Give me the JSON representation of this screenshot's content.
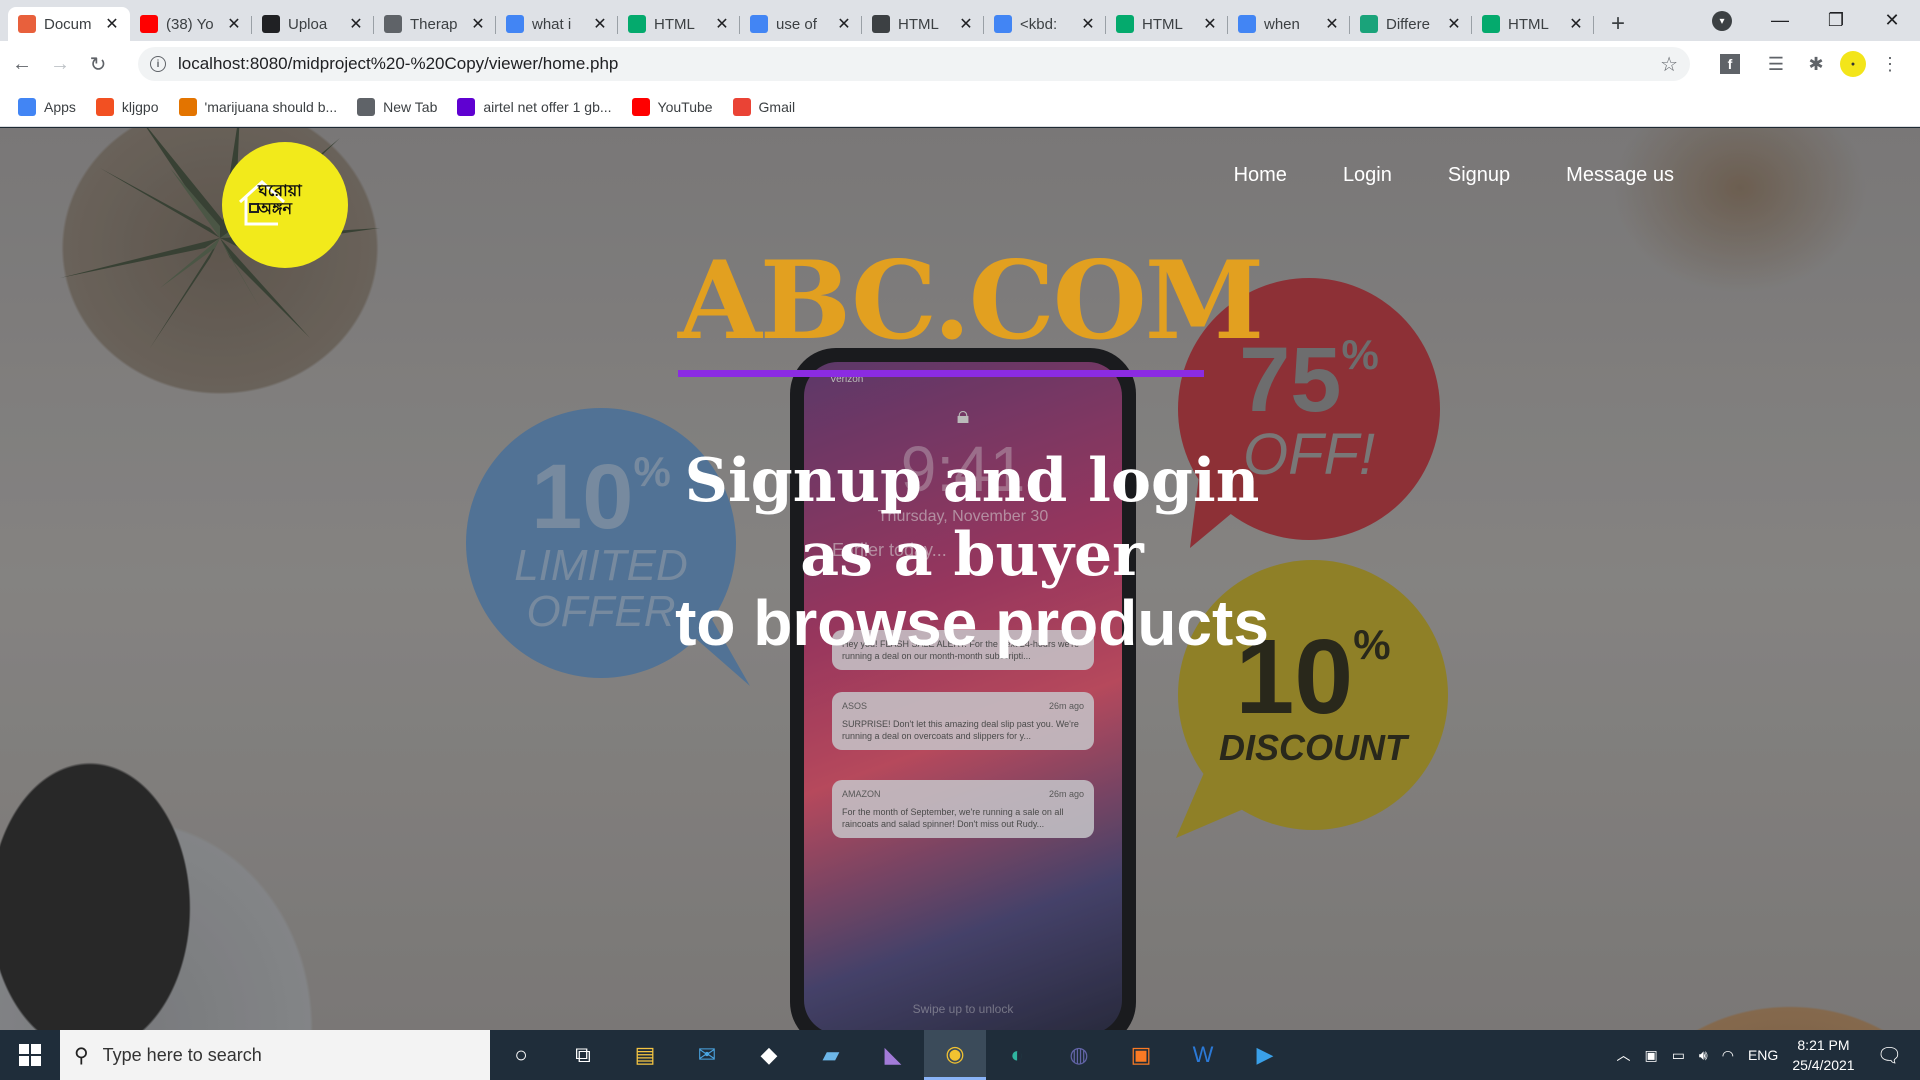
{
  "browser": {
    "tabs": [
      {
        "title": "Docum",
        "icon": "xampp-icon",
        "color": "#e8603c",
        "active": true
      },
      {
        "title": "(38) Yo",
        "icon": "youtube-icon",
        "color": "#ff0000"
      },
      {
        "title": "Uploa",
        "icon": "github-icon",
        "color": "#202124"
      },
      {
        "title": "Therap",
        "icon": "globe-icon",
        "color": "#5f6368"
      },
      {
        "title": "what i",
        "icon": "google-icon",
        "color": "#4285f4"
      },
      {
        "title": "HTML",
        "icon": "w3schools-icon",
        "color": "#04aa6d"
      },
      {
        "title": "use of",
        "icon": "google-icon",
        "color": "#4285f4"
      },
      {
        "title": "HTML",
        "icon": "diamond-icon",
        "color": "#3c4043"
      },
      {
        "title": "<kbd:",
        "icon": "google-icon",
        "color": "#4285f4"
      },
      {
        "title": "HTML",
        "icon": "w3schools-icon",
        "color": "#04aa6d"
      },
      {
        "title": "when",
        "icon": "google-icon",
        "color": "#4285f4"
      },
      {
        "title": "Differe",
        "icon": "shield-icon",
        "color": "#1aa37a"
      },
      {
        "title": "HTML",
        "icon": "w3schools-icon",
        "color": "#04aa6d"
      }
    ],
    "url": "localhost:8080/midproject%20-%20Copy/viewer/home.php",
    "bookmarks": [
      {
        "label": "Apps",
        "icon": "apps-grid-icon"
      },
      {
        "label": "kljgpo",
        "icon": "microsoft-icon"
      },
      {
        "label": "'marijuana should b...",
        "icon": "bookmark-favicon-icon"
      },
      {
        "label": "New Tab",
        "icon": "globe-icon"
      },
      {
        "label": "airtel net offer 1 gb...",
        "icon": "yahoo-icon"
      },
      {
        "label": "YouTube",
        "icon": "youtube-icon"
      },
      {
        "label": "Gmail",
        "icon": "gmail-icon"
      }
    ]
  },
  "site": {
    "logo_text": "ঘরোয়া অঙ্গন",
    "nav": [
      "Home",
      "Login",
      "Signup",
      "Message us"
    ],
    "brand": "ABC.COM",
    "tagline": [
      "Signup and login",
      "as a buyer",
      "to browse products"
    ],
    "colors": {
      "brand": "#e2a020",
      "underline": "#8b2be2",
      "logo_bg": "#f2ea1b"
    },
    "background": {
      "bubbles": [
        {
          "big": "75",
          "sub": "OFF!"
        },
        {
          "big": "10",
          "sub1": "LIMITED",
          "sub2": "OFFER"
        },
        {
          "big": "10",
          "sub": "DISCOUNT"
        }
      ],
      "percent_sign": "%",
      "phone": {
        "carrier": "Verizon",
        "time": "9:41",
        "date": "Thursday, November 30",
        "earlier": "Earlier today...",
        "notifications": [
          {
            "app": "",
            "time": "",
            "text": "Hey you! FLASH SALE ALERT. For the next 24-hours we're running a deal on our month-month subscripti..."
          },
          {
            "app": "ASOS",
            "time": "26m ago",
            "text": "SURPRISE! Don't let this amazing deal slip past you. We're running a deal on overcoats and slippers for y..."
          },
          {
            "app": "AMAZON",
            "time": "26m ago",
            "text": "For the month of September, we're running a sale on all raincoats and salad spinner! Don't miss out Rudy..."
          }
        ],
        "unlock": "Swipe up to unlock"
      }
    }
  },
  "taskbar": {
    "search_placeholder": "Type here to search",
    "apps": [
      "cortana-icon",
      "task-view-icon",
      "file-explorer-icon",
      "mail-icon",
      "dropbox-icon",
      "app-icon",
      "visual-studio-icon",
      "chrome-icon",
      "edge-icon",
      "teams-icon",
      "xampp-icon",
      "word-icon",
      "media-icon"
    ],
    "language": "ENG",
    "time": "8:21 PM",
    "date": "25/4/2021"
  }
}
